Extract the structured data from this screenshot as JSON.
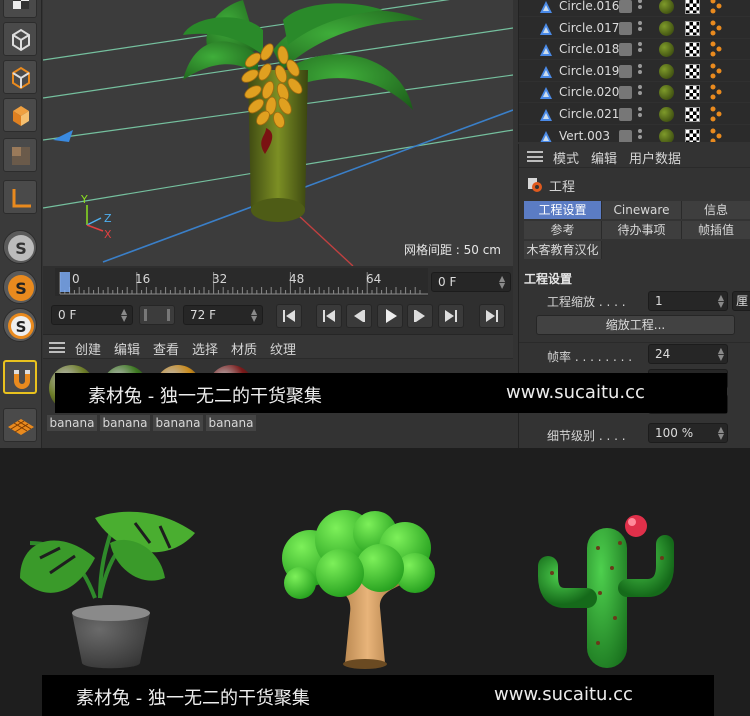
{
  "viewport": {
    "grid_label": "网格间距 : 50 cm",
    "axis_labels": {
      "x": "X",
      "y": "Y",
      "z": "Z"
    }
  },
  "timeline": {
    "ruler_ticks": [
      "0",
      "16",
      "32",
      "48",
      "64"
    ],
    "current_frame": "0 F",
    "start_frame": "0 F",
    "end_frame": "72 F"
  },
  "material_manager": {
    "menu": [
      "创建",
      "编辑",
      "查看",
      "选择",
      "材质",
      "纹理"
    ],
    "materials": [
      {
        "name": "banana",
        "color": "#6f7f2a"
      },
      {
        "name": "banana",
        "color": "#3e7a22"
      },
      {
        "name": "banana",
        "color": "#c98b1d"
      },
      {
        "name": "banana",
        "color": "#7a1a1a"
      }
    ]
  },
  "object_manager": {
    "rows": [
      "Circle.016",
      "Circle.017",
      "Circle.018",
      "Circle.019",
      "Circle.020",
      "Circle.021",
      "Vert.003"
    ]
  },
  "attribute_manager": {
    "menu": [
      "模式",
      "编辑",
      "用户数据"
    ],
    "header": "工程",
    "tabs_row1": [
      "工程设置",
      "Cineware",
      "信息"
    ],
    "tabs_row2": [
      "参考",
      "待办事项",
      "帧插值"
    ],
    "tab_row3": "木客教育汉化",
    "section_title": "工程设置",
    "project_scale_label": "工程缩放 . . . .",
    "project_scale_value": "1",
    "unit_stub": "厘",
    "scale_button": "缩放工程...",
    "fps_label": "帧率 . . . . . . . .",
    "fps_value": "24",
    "lod_label": "细节级别 . . . .",
    "lod_value": "100 %"
  },
  "watermark": {
    "text_cn": "素材兔 - 独一无二的干货聚集",
    "text_url": "www.sucaitu.cc"
  },
  "colors": {
    "accent": "#5b7cc4",
    "ui_bg": "#333333",
    "viewport_bg": "#3c3c3c",
    "grid_line": "#7fd8b0",
    "axis_line": "#3a7fc8"
  }
}
